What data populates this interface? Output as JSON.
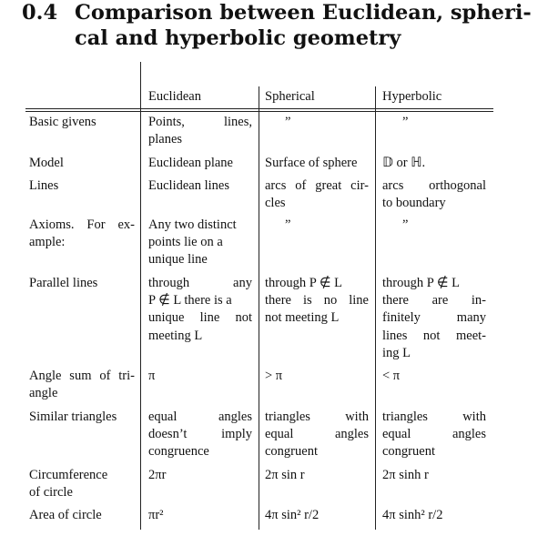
{
  "section": {
    "number": "0.4",
    "title_line1": "Comparison between Euclidean, spheri-",
    "title_line2": "cal and hyperbolic geometry"
  },
  "table": {
    "headers": {
      "euclidean": "Euclidean",
      "spherical": "Spherical",
      "hyperbolic": "Hyperbolic"
    },
    "rows": [
      {
        "label": [
          "Basic givens"
        ],
        "euclidean": [
          "Points, lines,",
          "planes"
        ],
        "spherical": [
          "”"
        ],
        "hyperbolic": [
          "”"
        ]
      },
      {
        "label": [
          "Model"
        ],
        "euclidean": [
          "Euclidean plane"
        ],
        "spherical": [
          "Surface of sphere"
        ],
        "hyperbolic": [
          "𝔻 or ℍ."
        ]
      },
      {
        "label": [
          "Lines"
        ],
        "euclidean": [
          "Euclidean lines"
        ],
        "spherical": [
          "arcs of great cir-",
          "cles"
        ],
        "hyperbolic": [
          "arcs orthogonal",
          "to boundary"
        ]
      },
      {
        "label": [
          "Axioms. For ex-",
          "ample:"
        ],
        "euclidean": [
          "Any two distinct",
          "points lie on a",
          "unique line"
        ],
        "spherical": [
          "”"
        ],
        "hyperbolic": [
          "”"
        ]
      },
      {
        "label": [
          "Parallel lines"
        ],
        "euclidean": [
          "through any",
          "P ∉ L there is a",
          "unique line not",
          "meeting L"
        ],
        "spherical": [
          "through P ∉ L",
          "there is no line",
          "not meeting L"
        ],
        "hyperbolic": [
          "through P ∉ L",
          "there are in-",
          "finitely many",
          "lines not meet-",
          "ing L"
        ]
      },
      {
        "label": [
          "Angle sum of tri-",
          "angle"
        ],
        "euclidean": [
          "π"
        ],
        "spherical": [
          "> π"
        ],
        "hyperbolic": [
          "< π"
        ]
      },
      {
        "label": [
          "Similar triangles"
        ],
        "euclidean": [
          "equal angles",
          "doesn’t imply",
          "congruence"
        ],
        "spherical": [
          "triangles with",
          "equal angles",
          "congruent"
        ],
        "hyperbolic": [
          "triangles with",
          "equal angles",
          "congruent"
        ]
      },
      {
        "label": [
          "Circumference",
          "of circle"
        ],
        "euclidean": [
          "2πr"
        ],
        "spherical": [
          "2π sin r"
        ],
        "hyperbolic": [
          "2π sinh r"
        ]
      },
      {
        "label": [
          "Area of circle"
        ],
        "euclidean": [
          "πr²"
        ],
        "spherical": [
          "4π sin² r/2"
        ],
        "hyperbolic": [
          "4π sinh² r/2"
        ]
      }
    ]
  }
}
